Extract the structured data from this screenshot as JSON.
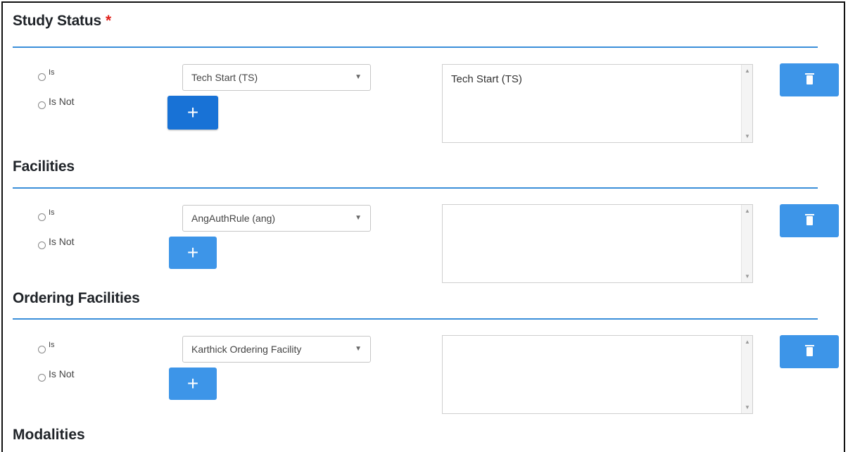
{
  "sections": [
    {
      "title": "Study Status",
      "required_mark": "*",
      "radio_is": "Is",
      "radio_is_not": "Is Not",
      "select_value": "Tech Start (TS)",
      "add_label": "+",
      "list_items": [
        "Tech Start (TS)"
      ]
    },
    {
      "title": "Facilities",
      "radio_is": "Is",
      "radio_is_not": "Is Not",
      "select_value": "AngAuthRule (ang)",
      "add_label": "+",
      "list_items": []
    },
    {
      "title": "Ordering Facilities",
      "radio_is": "Is",
      "radio_is_not": "Is Not",
      "select_value": "Karthick Ordering Facility",
      "add_label": "+",
      "list_items": []
    }
  ],
  "next_section_title": "Modalities",
  "icons": {
    "caret": "chevron-down-icon",
    "delete": "trash-icon",
    "scroll_up": "scroll-up-icon",
    "scroll_down": "scroll-down-icon"
  },
  "colors": {
    "accent": "#3d95e8",
    "accent_dark": "#1872d6",
    "rule": "#3b8fd9",
    "required": "#e0201b"
  }
}
